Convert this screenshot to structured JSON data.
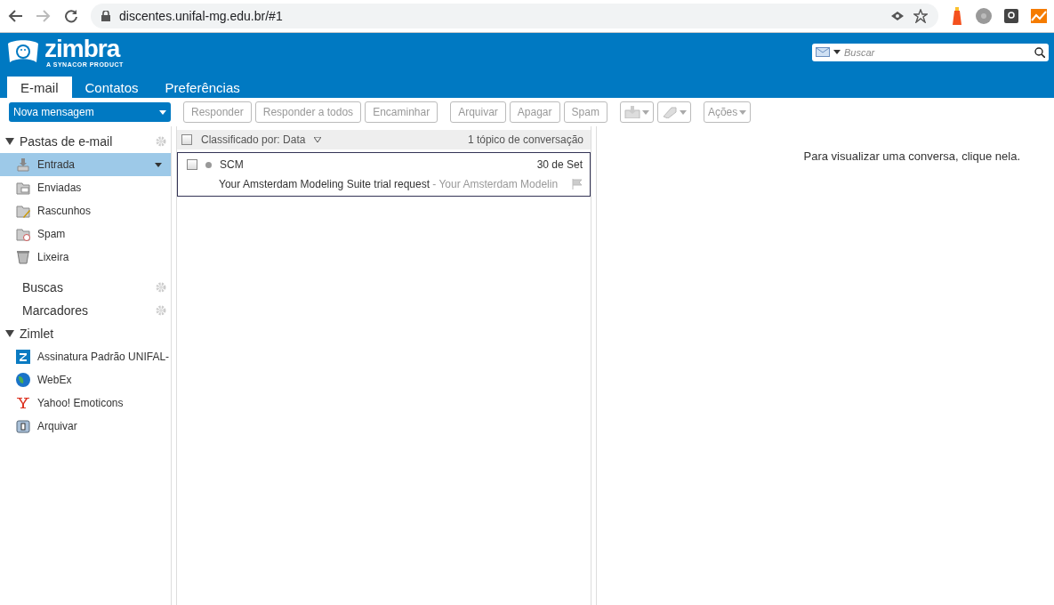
{
  "browser": {
    "url": "discentes.unifal-mg.edu.br/#1"
  },
  "header": {
    "logo": {
      "name": "zimbra",
      "tagline": "A SYNACOR PRODUCT"
    },
    "search": {
      "placeholder": "Buscar"
    }
  },
  "tabs": [
    {
      "label": "E-mail",
      "selected": true
    },
    {
      "label": "Contatos",
      "selected": false
    },
    {
      "label": "Preferências",
      "selected": false
    }
  ],
  "new_button": {
    "label": "Nova mensagem"
  },
  "toolbar": [
    {
      "label": "Responder",
      "disabled": true
    },
    {
      "label": "Responder a todos",
      "disabled": true
    },
    {
      "label": "Encaminhar",
      "disabled": true
    },
    {
      "label": "Arquivar",
      "disabled": true
    },
    {
      "label": "Apagar",
      "disabled": true
    },
    {
      "label": "Spam",
      "disabled": true
    }
  ],
  "actions_button": {
    "label": "Ações",
    "disabled": true
  },
  "sidebar": {
    "folders_header": "Pastas de e-mail",
    "folders": [
      {
        "label": "Entrada",
        "selected": true
      },
      {
        "label": "Enviadas",
        "selected": false
      },
      {
        "label": "Rascunhos",
        "selected": false
      },
      {
        "label": "Spam",
        "selected": false
      },
      {
        "label": "Lixeira",
        "selected": false
      }
    ],
    "searches": "Buscas",
    "tags": "Marcadores",
    "zimlet_header": "Zimlet",
    "zimlets": [
      {
        "label": "Assinatura Padrão UNIFAL-"
      },
      {
        "label": "WebEx"
      },
      {
        "label": "Yahoo! Emoticons"
      },
      {
        "label": "Arquivar"
      }
    ]
  },
  "list": {
    "select_all": {
      "checked": false
    },
    "sort_label": "Classificado por: Data",
    "count": "1 tópico de conversação",
    "rows": [
      {
        "sender": "SCM",
        "date": "30 de Set",
        "subject": "Your Amsterdam Modeling Suite trial request",
        "preview": " - Your Amsterdam Modelin",
        "checked": false,
        "unread": false
      }
    ]
  },
  "reading_pane": {
    "hint": "Para visualizar uma conversa, clique nela."
  }
}
